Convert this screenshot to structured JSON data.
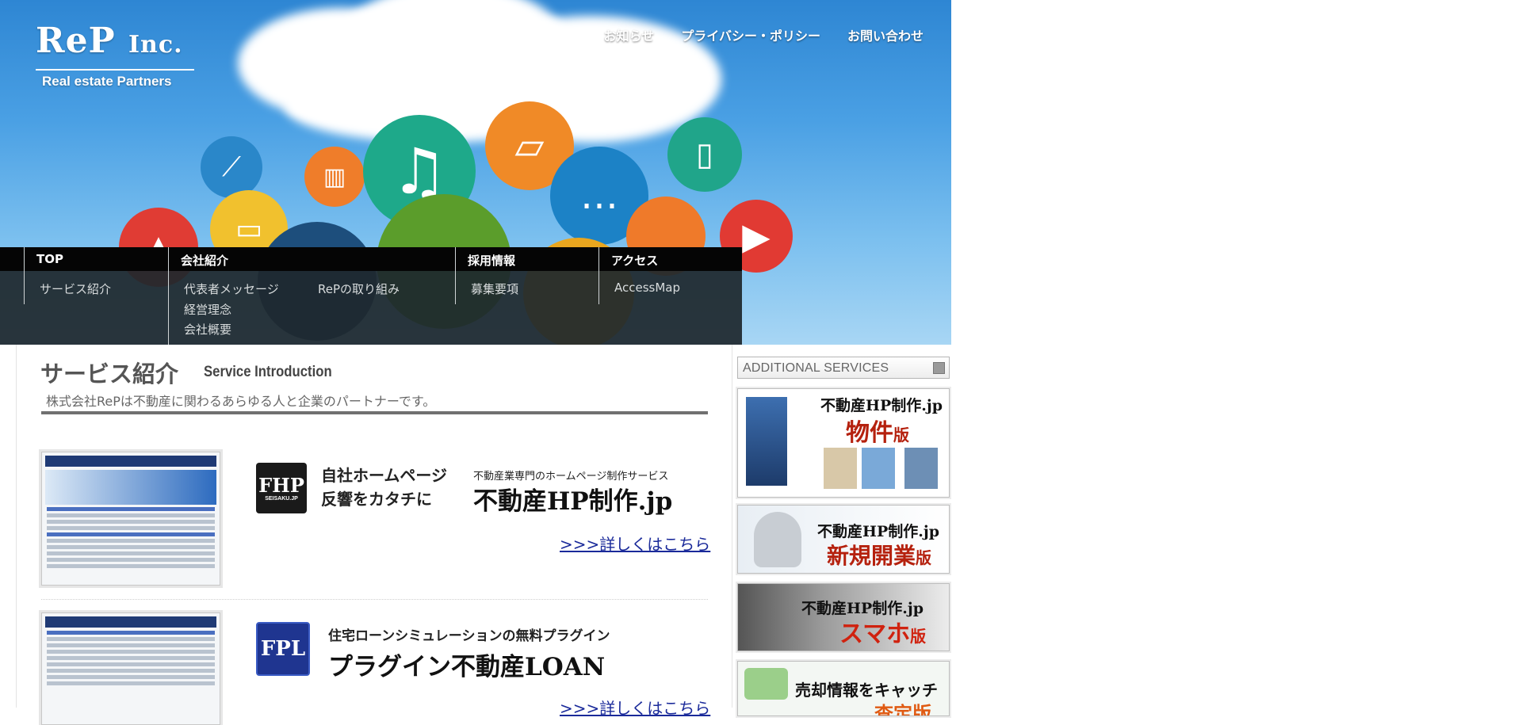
{
  "logo": {
    "main": "ReP",
    "suffix": "Inc.",
    "sub": "Real estate Partners"
  },
  "top_nav": [
    "お知らせ",
    "プライバシー・ポリシー",
    "お問い合わせ"
  ],
  "mega_menu": {
    "top": {
      "title": "TOP",
      "links": [
        "サービス紹介"
      ]
    },
    "company": {
      "title": "会社紹介",
      "links": [
        "代表者メッセージ",
        "RePの取り組み",
        "経営理念",
        "会社概要"
      ]
    },
    "recruit": {
      "title": "採用情報",
      "links": [
        "募集要項"
      ]
    },
    "access": {
      "title": "アクセス",
      "links": [
        "AccessMap"
      ]
    }
  },
  "section": {
    "title": "サービス紹介",
    "subtitle": "Service Introduction",
    "description": "株式会社RePは不動産に関わるあらゆる人と企業のパートナーです。"
  },
  "services": [
    {
      "logo_text": "FHP",
      "logo_sub": "SEISAKU.JP",
      "logo_color": "#1a1a1a",
      "copy_line1": "自社ホームページ",
      "copy_line2": "反響をカタチに",
      "tag": "不動産業専門のホームページ制作サービス",
      "name": "不動産HP制作.jp",
      "more": ">>>詳しくはこちら"
    },
    {
      "logo_text": "FPL",
      "logo_sub": "",
      "logo_color": "#1f3590",
      "copy_line1": "住宅ローンシミュレーションの無料プラグイン",
      "copy_line2": "",
      "tag": "",
      "name": "プラグイン不動産LOAN",
      "more": ">>>詳しくはこちら"
    }
  ],
  "sidebar": {
    "header": "ADDITIONAL SERVICES",
    "banners": [
      {
        "line1": "不動産HP制作.jp",
        "line2": "物件",
        "suffix": "版"
      },
      {
        "line1": "不動産HP制作.jp",
        "line2": "新規開業",
        "suffix": "版"
      },
      {
        "line1": "不動産HP制作.jp",
        "line2": "スマホ",
        "suffix": "版"
      },
      {
        "line1": "売却情報をキャッチ",
        "line2": "査定版",
        "suffix": ""
      }
    ]
  },
  "colors": {
    "sky": "#2e86d3",
    "menu_bg": "#1e282d",
    "link": "#1a2a9a",
    "banner_red": "#b5210e"
  }
}
